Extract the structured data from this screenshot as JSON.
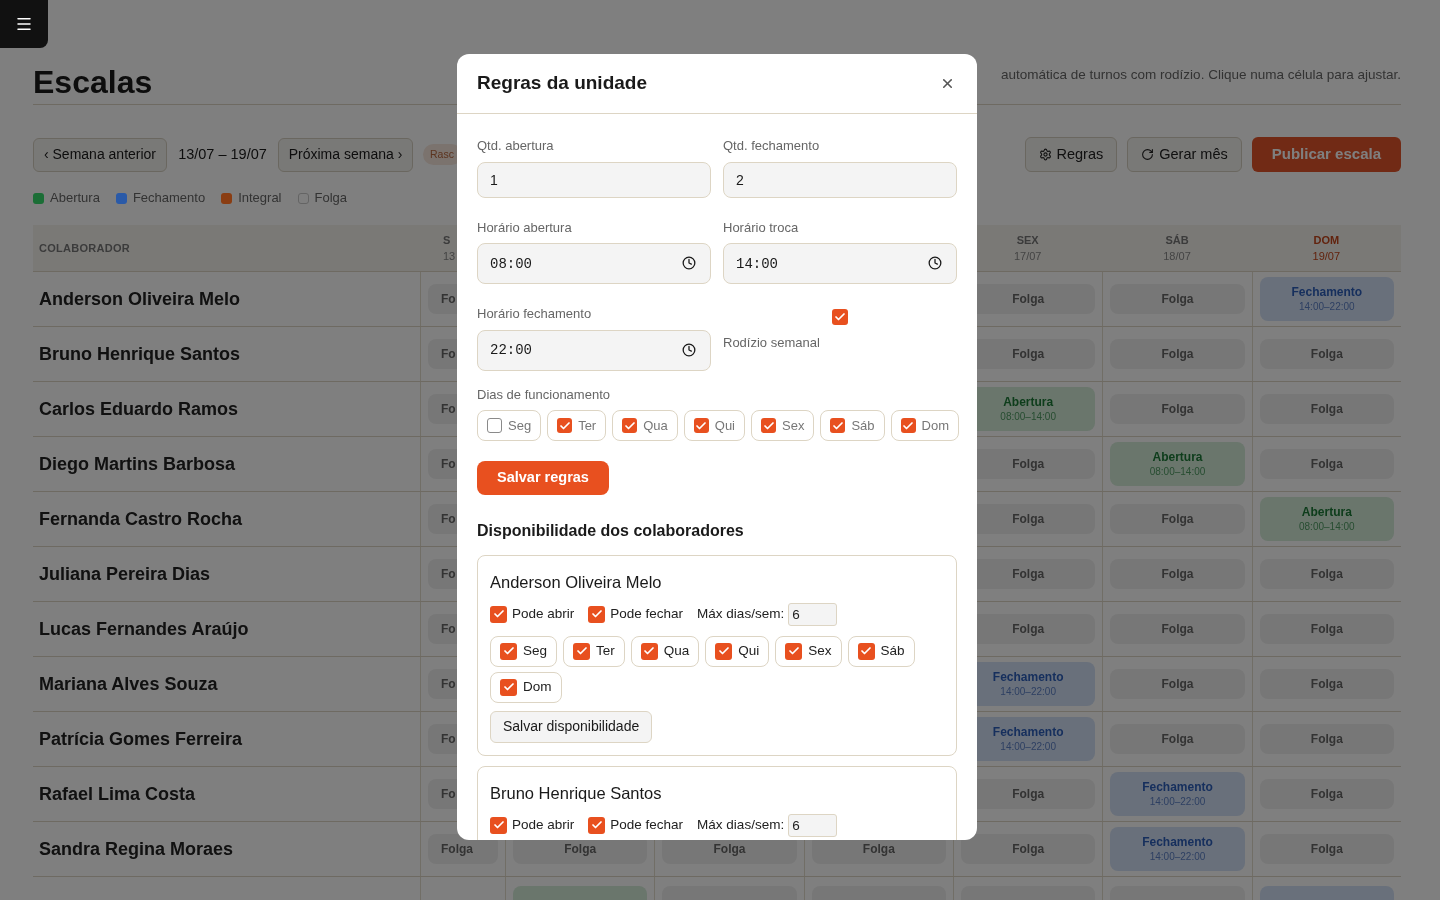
{
  "page": {
    "title": "Escalas",
    "subtitle": "automática de turnos com rodízio. Clique numa célula para ajustar."
  },
  "toolbar": {
    "prev": "‹ Semana anterior",
    "range": "13/07 – 19/07",
    "next": "Próxima semana ›",
    "status_badge": "Rasc",
    "actions": [
      {
        "kind": "rules",
        "label": "Regras"
      },
      {
        "kind": "generate",
        "label": "Gerar mês"
      },
      {
        "kind": "publish",
        "label": "Publicar escala"
      }
    ]
  },
  "legend": [
    {
      "label": "Abertura",
      "color": "#1b6e36"
    },
    {
      "label": "Fechamento",
      "color": "#2a5aa8"
    },
    {
      "label": "Integral",
      "color": "#8a3d12"
    },
    {
      "label": "Folga"
    }
  ],
  "table": {
    "name_header": "COLABORADOR",
    "days": [
      {
        "day": "S",
        "date": "13",
        "highlight": false
      },
      {
        "day": "SEX",
        "date": "17/07",
        "highlight": false
      },
      {
        "day": "SÁB",
        "date": "18/07",
        "highlight": false
      },
      {
        "day": "DOM",
        "date": "19/07",
        "highlight": true
      }
    ],
    "rows": [
      {
        "name": "Anderson Oliveira Melo",
        "cells": [
          {
            "kind": "folga",
            "label": "Fo"
          },
          null,
          null,
          null,
          {
            "kind": "folga",
            "label": "Folga"
          },
          {
            "kind": "folga",
            "label": "Folga"
          },
          {
            "kind": "fechamento",
            "label": "Fechamento",
            "time": "14:00–22:00"
          }
        ]
      },
      {
        "name": "Bruno Henrique Santos",
        "cells": [
          {
            "kind": "folga",
            "label": "Fo"
          },
          null,
          null,
          null,
          {
            "kind": "folga",
            "label": "Folga"
          },
          {
            "kind": "folga",
            "label": "Folga"
          },
          {
            "kind": "folga",
            "label": "Folga"
          }
        ]
      },
      {
        "name": "Carlos Eduardo Ramos",
        "cells": [
          {
            "kind": "folga",
            "label": "Fo"
          },
          null,
          null,
          null,
          {
            "kind": "abertura",
            "label": "Abertura",
            "time": "08:00–14:00"
          },
          {
            "kind": "folga",
            "label": "Folga"
          },
          {
            "kind": "folga",
            "label": "Folga"
          }
        ]
      },
      {
        "name": "Diego Martins Barbosa",
        "cells": [
          {
            "kind": "folga",
            "label": "Fo"
          },
          null,
          null,
          null,
          {
            "kind": "folga",
            "label": "Folga"
          },
          {
            "kind": "abertura",
            "label": "Abertura",
            "time": "08:00–14:00"
          },
          {
            "kind": "folga",
            "label": "Folga"
          }
        ]
      },
      {
        "name": "Fernanda Castro Rocha",
        "cells": [
          {
            "kind": "folga",
            "label": "Fo"
          },
          null,
          null,
          null,
          {
            "kind": "folga",
            "label": "Folga"
          },
          {
            "kind": "folga",
            "label": "Folga"
          },
          {
            "kind": "abertura",
            "label": "Abertura",
            "time": "08:00–14:00"
          }
        ]
      },
      {
        "name": "Juliana Pereira Dias",
        "cells": [
          {
            "kind": "folga",
            "label": "Fo"
          },
          null,
          null,
          null,
          {
            "kind": "folga",
            "label": "Folga"
          },
          {
            "kind": "folga",
            "label": "Folga"
          },
          {
            "kind": "folga",
            "label": "Folga"
          }
        ]
      },
      {
        "name": "Lucas Fernandes Araújo",
        "cells": [
          {
            "kind": "folga",
            "label": "Fo"
          },
          null,
          null,
          null,
          {
            "kind": "folga",
            "label": "Folga"
          },
          {
            "kind": "folga",
            "label": "Folga"
          },
          {
            "kind": "folga",
            "label": "Folga"
          }
        ]
      },
      {
        "name": "Mariana Alves Souza",
        "cells": [
          {
            "kind": "folga",
            "label": "Fo"
          },
          null,
          null,
          null,
          {
            "kind": "fechamento",
            "label": "Fechamento",
            "time": "14:00–22:00"
          },
          {
            "kind": "folga",
            "label": "Folga"
          },
          {
            "kind": "folga",
            "label": "Folga"
          }
        ]
      },
      {
        "name": "Patrícia Gomes Ferreira",
        "cells": [
          {
            "kind": "folga",
            "label": "Fo"
          },
          null,
          null,
          null,
          {
            "kind": "fechamento",
            "label": "Fechamento",
            "time": "14:00–22:00"
          },
          {
            "kind": "folga",
            "label": "Folga"
          },
          {
            "kind": "folga",
            "label": "Folga"
          }
        ]
      },
      {
        "name": "Rafael Lima Costa",
        "cells": [
          {
            "kind": "folga",
            "label": "Fo"
          },
          null,
          null,
          null,
          {
            "kind": "folga",
            "label": "Folga"
          },
          {
            "kind": "fechamento",
            "label": "Fechamento",
            "time": "14:00–22:00"
          },
          {
            "kind": "folga",
            "label": "Folga"
          }
        ]
      },
      {
        "name": "Sandra Regina Moraes",
        "cells": [
          {
            "kind": "folga",
            "label": "Folga"
          },
          {
            "kind": "folga",
            "label": "Folga"
          },
          {
            "kind": "folga",
            "label": "Folga"
          },
          {
            "kind": "folga",
            "label": "Folga"
          },
          {
            "kind": "folga",
            "label": "Folga"
          },
          {
            "kind": "fechamento",
            "label": "Fechamento",
            "time": "14:00–22:00"
          },
          {
            "kind": "folga",
            "label": "Folga"
          }
        ]
      },
      {
        "cells": [
          null,
          {
            "kind": "abertura"
          },
          {
            "kind": "folga"
          },
          {
            "kind": "folga"
          },
          {
            "kind": "folga"
          },
          {
            "kind": "folga"
          },
          {
            "kind": "fechamento"
          }
        ]
      }
    ]
  },
  "modal": {
    "title": "Regras da unidade",
    "fields": [
      {
        "kind": "number",
        "label": "Qtd. abertura",
        "value": "1"
      },
      {
        "kind": "number",
        "label": "Qtd. fechamento",
        "value": "2"
      },
      {
        "kind": "time",
        "label": "Horário abertura",
        "value": "08:00"
      },
      {
        "kind": "time",
        "label": "Horário troca",
        "value": "14:00"
      },
      {
        "kind": "time",
        "label": "Horário fechamento",
        "value": "22:00"
      },
      {
        "kind": "checkbox",
        "label": "Rodízio semanal",
        "checked": true
      }
    ],
    "days_label": "Dias de funcionamento",
    "days": [
      {
        "label": "Seg",
        "checked": false
      },
      {
        "label": "Ter",
        "checked": true
      },
      {
        "label": "Qua",
        "checked": true
      },
      {
        "label": "Qui",
        "checked": true
      },
      {
        "label": "Sex",
        "checked": true
      },
      {
        "label": "Sáb",
        "checked": true
      },
      {
        "label": "Dom",
        "checked": true
      }
    ],
    "save": "Salvar regras",
    "availability_title": "Disponibilidade dos colaboradores",
    "employees": [
      {
        "name": "Anderson Oliveira Melo",
        "can_open": {
          "label": "Pode abrir",
          "checked": true
        },
        "can_close": {
          "label": "Pode fechar",
          "checked": true
        },
        "max_days": {
          "label": "Máx dias/sem:",
          "value": "6"
        },
        "days": [
          {
            "label": "Seg",
            "checked": true
          },
          {
            "label": "Ter",
            "checked": true
          },
          {
            "label": "Qua",
            "checked": true
          },
          {
            "label": "Qui",
            "checked": true
          },
          {
            "label": "Sex",
            "checked": true
          },
          {
            "label": "Sáb",
            "checked": true
          },
          {
            "label": "Dom",
            "checked": true
          }
        ],
        "save": "Salvar disponibilidade"
      },
      {
        "name": "Bruno Henrique Santos",
        "can_open": {
          "label": "Pode abrir",
          "checked": true
        },
        "can_close": {
          "label": "Pode fechar",
          "checked": true
        },
        "max_days": {
          "label": "Máx dias/sem:",
          "value": "6"
        }
      }
    ]
  }
}
